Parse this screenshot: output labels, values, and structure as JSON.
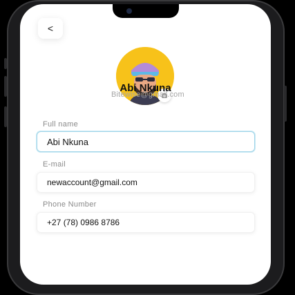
{
  "screen": {
    "back_label": "<"
  },
  "profile": {
    "name": "Abi Nkuna",
    "email": "Bitewise@gmail.com"
  },
  "form": {
    "full_name": {
      "label": "Full name",
      "value": "Abi Nkuna"
    },
    "email": {
      "label": "E-mail",
      "value": "newaccount@gmail.com"
    },
    "phone": {
      "label": "Phone Number",
      "value": "+27 (78) 0986 8786"
    }
  },
  "colors": {
    "avatar_bg": "#f7c21a",
    "active_border": "#9fd4e8"
  },
  "icons": [
    "back-chevron",
    "camera-icon",
    "avatar-illustration"
  ]
}
